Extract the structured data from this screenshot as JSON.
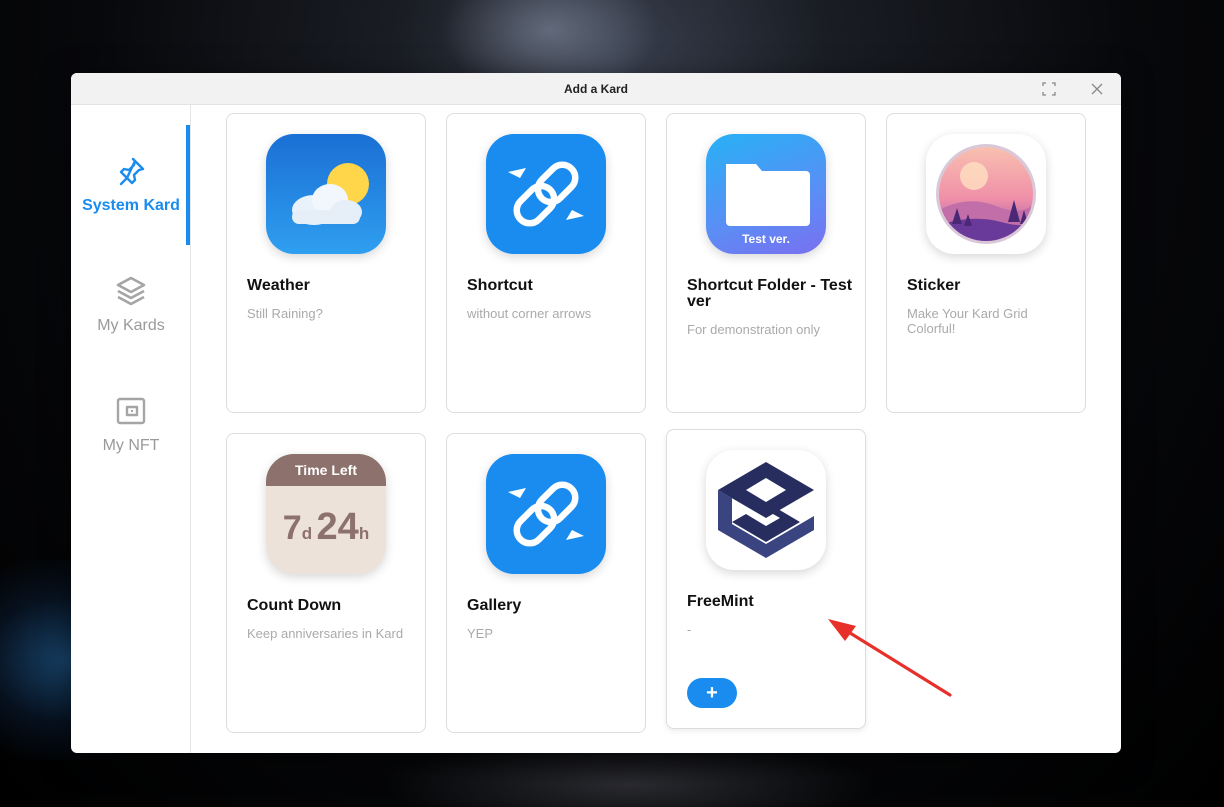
{
  "window": {
    "title": "Add a Kard"
  },
  "sidebar": {
    "items": [
      {
        "label": "System Kard",
        "icon": "pin-icon",
        "active": true
      },
      {
        "label": "My Kards",
        "icon": "stack-icon",
        "active": false
      },
      {
        "label": "My NFT",
        "icon": "wallet-icon",
        "active": false
      }
    ]
  },
  "kards": [
    {
      "name": "Weather",
      "desc": "Still Raining?",
      "icon": "weather-icon"
    },
    {
      "name": "Shortcut",
      "desc": "without corner arrows",
      "icon": "link-icon"
    },
    {
      "name": "Shortcut Folder - Test ver",
      "desc": "For demonstration only",
      "icon": "folder-icon",
      "icon_badge": "Test ver."
    },
    {
      "name": "Sticker",
      "desc": "Make Your Kard Grid Colorful!",
      "icon": "sticker-icon"
    },
    {
      "name": "Count Down",
      "desc": "Keep anniversaries in Kard",
      "icon": "countdown-icon",
      "icon_header": "Time Left",
      "icon_days": "7",
      "icon_days_unit": "d",
      "icon_hours": "24",
      "icon_hours_unit": "h"
    },
    {
      "name": "Gallery",
      "desc": "YEP",
      "icon": "link-icon"
    },
    {
      "name": "FreeMint",
      "desc": "-",
      "icon": "freemint-logo-icon",
      "add_label": "+"
    }
  ],
  "colors": {
    "accent": "#1a8cf0",
    "annotation_arrow": "#e8302a"
  }
}
